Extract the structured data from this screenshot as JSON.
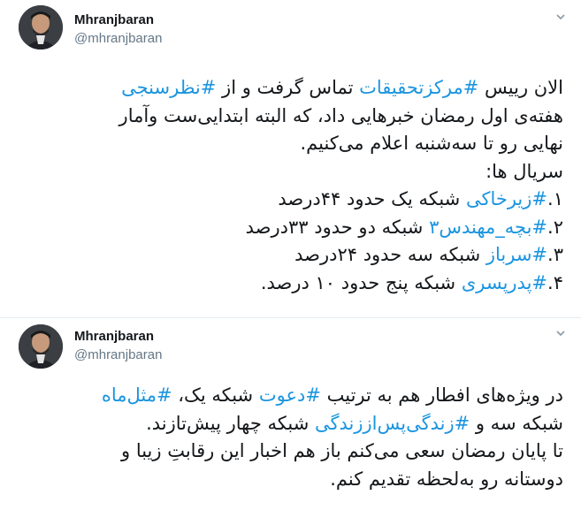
{
  "tweets": [
    {
      "name": "Mhranjbaran",
      "handle": "@mhranjbaran",
      "lines": [
        [
          {
            "t": "الان رییس "
          },
          {
            "t": "#مرکزتحقیقات",
            "h": true
          },
          {
            "t": " تماس گرفت و از "
          },
          {
            "t": "#نظرسنجی",
            "h": true
          }
        ],
        [
          {
            "t": "هفته‌ی اول رمضان خبرهایی داد، که البته ابتدایی‌ست و‌آمار"
          }
        ],
        [
          {
            "t": "نهایی رو تا سه‌شنبه اعلام می‌کنیم."
          }
        ],
        [
          {
            "t": "سریال ها:"
          }
        ],
        [
          {
            "t": "۱."
          },
          {
            "t": "#زیرخاکی",
            "h": true
          },
          {
            "t": " شبکه یک حدود ۴۴درصد"
          }
        ],
        [
          {
            "t": "۲."
          },
          {
            "t": "#بچه_مهندس۳",
            "h": true
          },
          {
            "t": " شبکه دو حدود ۳۳درصد"
          }
        ],
        [
          {
            "t": "۳."
          },
          {
            "t": "#سرباز",
            "h": true
          },
          {
            "t": " شبکه سه حدود ۲۴درصد"
          }
        ],
        [
          {
            "t": "۴."
          },
          {
            "t": "#پدرپسری",
            "h": true
          },
          {
            "t": " شبکه پنج حدود ۱۰ درصد."
          }
        ]
      ]
    },
    {
      "name": "Mhranjbaran",
      "handle": "@mhranjbaran",
      "lines": [
        [
          {
            "t": "در ویژه‌های افطار هم به ترتیب "
          },
          {
            "t": "#دعوت",
            "h": true
          },
          {
            "t": " شبکه یک، "
          },
          {
            "t": "#مثل‌ماه",
            "h": true
          }
        ],
        [
          {
            "t": "شبکه سه و "
          },
          {
            "t": "#زندگی‌پس‌اززندگی",
            "h": true
          },
          {
            "t": " شبکه چهار پیش‌تازند."
          }
        ],
        [
          {
            "t": "تا پایان رمضان سعی می‌کنم باز هم اخبار این رقابتِ زیبا و"
          }
        ],
        [
          {
            "t": "دوستانه رو به‌لحظه تقدیم کنم."
          }
        ]
      ]
    }
  ],
  "colors": {
    "hashtag": "#1b95e0",
    "text": "#14171a",
    "handle": "#657786"
  },
  "icons": {
    "menu": "chevron-down-icon"
  }
}
